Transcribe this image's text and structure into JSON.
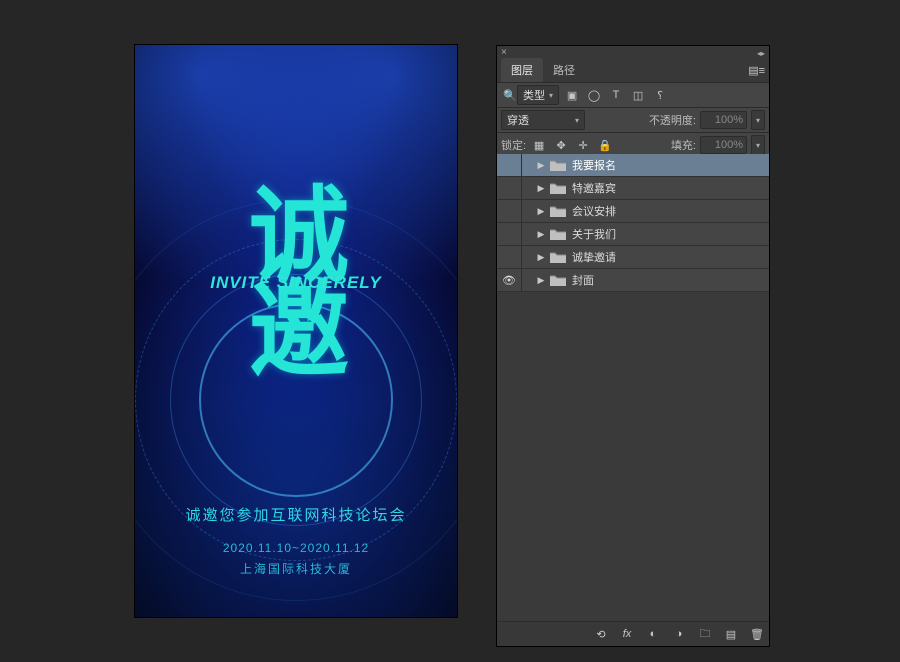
{
  "poster": {
    "title_cn": "诚\n邀",
    "title_en": "INVITE SINCERELY",
    "subtitle": "诚邀您参加互联网科技论坛会",
    "dates": "2020.11.10~2020.11.12",
    "location": "上海国际科技大厦"
  },
  "panel": {
    "tabs": {
      "layers": "图层",
      "paths": "路径"
    },
    "filter": {
      "label": "类型"
    },
    "blend": {
      "mode": "穿透",
      "opacity_label": "不透明度:",
      "opacity_value": "100%"
    },
    "lock": {
      "label": "锁定:",
      "fill_label": "填充:",
      "fill_value": "100%"
    },
    "layers": [
      {
        "name": "我要报名",
        "visible": false,
        "selected": true
      },
      {
        "name": "特邀嘉宾",
        "visible": false,
        "selected": false
      },
      {
        "name": "会议安排",
        "visible": false,
        "selected": false
      },
      {
        "name": "关于我们",
        "visible": false,
        "selected": false
      },
      {
        "name": "诚挚邀请",
        "visible": false,
        "selected": false
      },
      {
        "name": "封面",
        "visible": true,
        "selected": false
      }
    ]
  },
  "icons": {
    "search": "🔍",
    "image": "▣",
    "circle": "◯",
    "type": "T",
    "crop": "◫",
    "effects": "⸮",
    "lock_pixels": "▦",
    "lock_move": "✥",
    "lock_pos": "✛",
    "lock_all": "🔒",
    "eye": "👁",
    "link": "⟲",
    "fx": "fx",
    "mask": "◐",
    "adjust": "◑",
    "newgrp": "🗀",
    "new": "▤",
    "trash": "🗑"
  }
}
